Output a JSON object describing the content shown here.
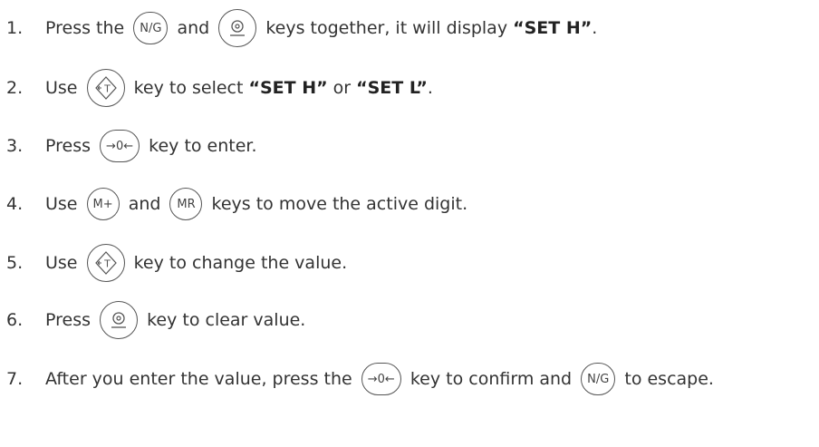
{
  "steps": [
    {
      "number": "1.",
      "parts": [
        {
          "t": "text",
          "v": "Press the "
        },
        {
          "t": "key",
          "v": "N/G",
          "name": "net-gross-key"
        },
        {
          "t": "text",
          "v": " and "
        },
        {
          "t": "key",
          "icon": "power",
          "name": "power-key"
        },
        {
          "t": "text",
          "v": " keys together, it will display "
        },
        {
          "t": "bold",
          "v": "“SET H”"
        },
        {
          "t": "text",
          "v": "."
        }
      ]
    },
    {
      "number": "2.",
      "parts": [
        {
          "t": "text",
          "v": "Use "
        },
        {
          "t": "key",
          "icon": "tare",
          "name": "tare-key"
        },
        {
          "t": "text",
          "v": " key to select "
        },
        {
          "t": "bold",
          "v": "“SET H”"
        },
        {
          "t": "text",
          "v": " or "
        },
        {
          "t": "bold",
          "v": "“SET L”"
        },
        {
          "t": "text",
          "v": "."
        }
      ]
    },
    {
      "number": "3.",
      "parts": [
        {
          "t": "text",
          "v": "Press "
        },
        {
          "t": "key",
          "v": "→0←",
          "name": "zero-key"
        },
        {
          "t": "text",
          "v": " key to enter."
        }
      ]
    },
    {
      "number": "4.",
      "parts": [
        {
          "t": "text",
          "v": "Use "
        },
        {
          "t": "key",
          "v": "M+",
          "name": "memory-plus-key"
        },
        {
          "t": "text",
          "v": " and "
        },
        {
          "t": "key",
          "v": "MR",
          "name": "memory-recall-key"
        },
        {
          "t": "text",
          "v": " keys to move the active digit."
        }
      ]
    },
    {
      "number": "5.",
      "parts": [
        {
          "t": "text",
          "v": "Use "
        },
        {
          "t": "key",
          "icon": "tare",
          "name": "tare-key"
        },
        {
          "t": "text",
          "v": " key to change the value."
        }
      ]
    },
    {
      "number": "6.",
      "parts": [
        {
          "t": "text",
          "v": "Press "
        },
        {
          "t": "key",
          "icon": "power",
          "name": "power-key"
        },
        {
          "t": "text",
          "v": " key to clear value."
        }
      ]
    },
    {
      "number": "7.",
      "parts": [
        {
          "t": "text",
          "v": "After you enter the value, press the "
        },
        {
          "t": "key",
          "v": "→0←",
          "name": "zero-key"
        },
        {
          "t": "text",
          "v": " key to confirm and "
        },
        {
          "t": "key",
          "v": "N/G",
          "name": "net-gross-key"
        },
        {
          "t": "text",
          "v": " to escape."
        }
      ]
    }
  ],
  "icons": {
    "power": "power-icon",
    "tare": "tare-arrow-icon"
  },
  "colors": {
    "text": "#333333",
    "key_border": "#555555"
  }
}
